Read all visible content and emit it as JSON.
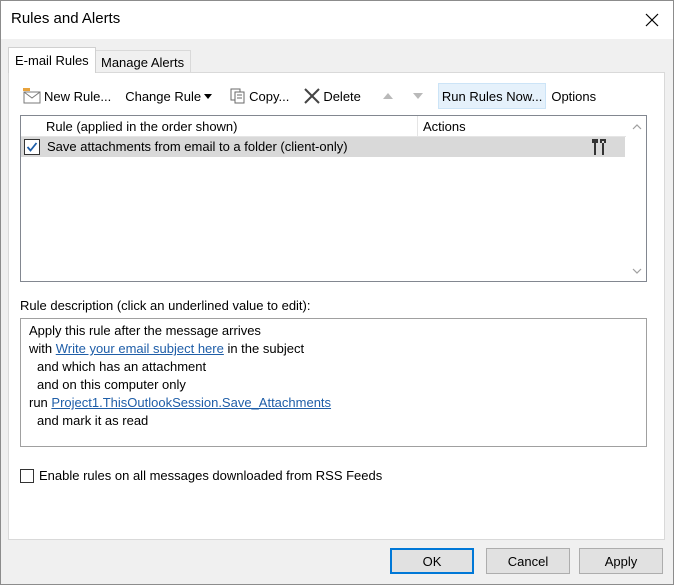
{
  "window": {
    "title": "Rules and Alerts",
    "close_icon": "close-icon"
  },
  "tabs": [
    {
      "label": "E-mail Rules",
      "active": true
    },
    {
      "label": "Manage Alerts",
      "active": false
    }
  ],
  "toolbar": {
    "new_rule": "New Rule...",
    "change_rule": "Change Rule",
    "copy": "Copy...",
    "delete": "Delete",
    "run_rules_now": "Run Rules Now...",
    "options": "Options"
  },
  "rule_list": {
    "columns": [
      "Rule (applied in the order shown)",
      "Actions"
    ],
    "rows": [
      {
        "checked": true,
        "name": "Save attachments from email to a folder  (client-only)",
        "action_icon": "tools-icon"
      }
    ]
  },
  "description": {
    "label": "Rule description (click an underlined value to edit):",
    "line1": "Apply this rule after the message arrives",
    "line2_prefix": "with ",
    "line2_link": "Write your email subject here",
    "line2_suffix": " in the subject",
    "line3": "and which has an attachment",
    "line4": "and on this computer only",
    "line5_prefix": "run ",
    "line5_link": "Project1.ThisOutlookSession.Save_Attachments",
    "line6": "and mark it as read"
  },
  "rss_option": {
    "label": "Enable rules on all messages downloaded from RSS Feeds",
    "checked": false
  },
  "buttons": {
    "ok": "OK",
    "cancel": "Cancel",
    "apply": "Apply"
  },
  "colors": {
    "link": "#1f5ea8",
    "selected_row": "#d9d9d9",
    "default_button_border": "#0078d7",
    "check": "#1f5ea8"
  }
}
